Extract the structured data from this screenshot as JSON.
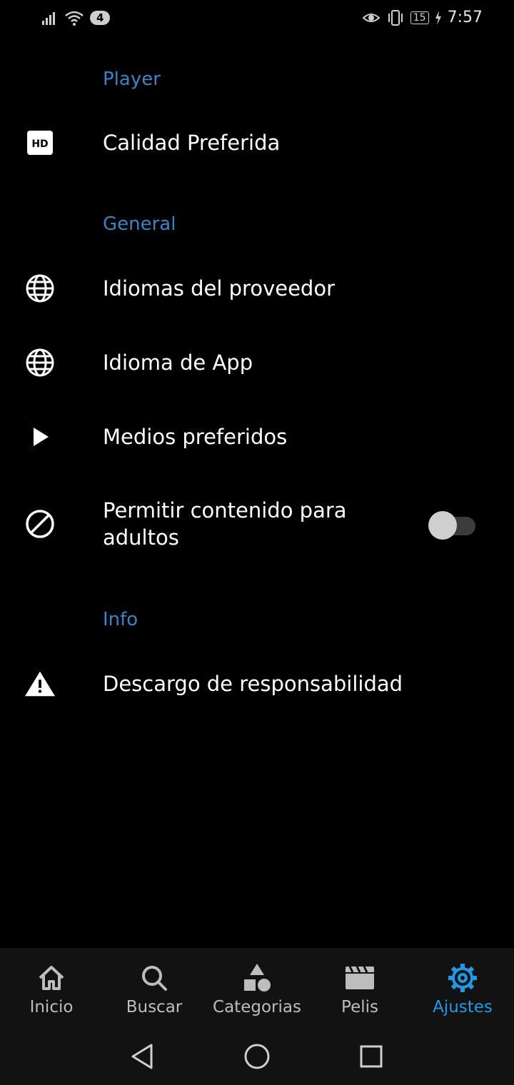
{
  "status_bar": {
    "notification_count": "4",
    "battery": "15",
    "time": "7:57",
    "icons": [
      "signal-icon",
      "wifi-icon",
      "eye-icon",
      "vibrate-icon",
      "battery-icon",
      "charging-icon"
    ]
  },
  "settings": {
    "sections": [
      {
        "title": "Player"
      },
      {
        "title": "General"
      },
      {
        "title": "Info"
      }
    ],
    "items": [
      {
        "label": "Calidad Preferida",
        "icon": "hd-icon"
      },
      {
        "label": "Idiomas del proveedor",
        "icon": "globe-icon"
      },
      {
        "label": "Idioma de App",
        "icon": "globe-icon"
      },
      {
        "label": "Medios preferidos",
        "icon": "play-icon"
      },
      {
        "label_line1": "Permitir contenido para",
        "label_line2": "adultos",
        "icon": "block-icon",
        "toggle_on": false
      },
      {
        "label": "Descargo de responsabilidad",
        "icon": "warning-icon"
      }
    ]
  },
  "bottom_nav": {
    "items": [
      {
        "label": "Inicio",
        "icon": "home-icon"
      },
      {
        "label": "Buscar",
        "icon": "search-icon"
      },
      {
        "label": "Categorias",
        "icon": "shapes-icon"
      },
      {
        "label": "Pelis",
        "icon": "clapperboard-icon"
      },
      {
        "label": "Ajustes",
        "icon": "gear-icon",
        "active": true
      }
    ],
    "active_color": "#1e9be8"
  },
  "system_nav": [
    "back-icon",
    "home-circle-icon",
    "recents-icon"
  ],
  "colors": {
    "section_title": "#3d82c4",
    "background": "#000000",
    "nav_background": "#121212"
  }
}
